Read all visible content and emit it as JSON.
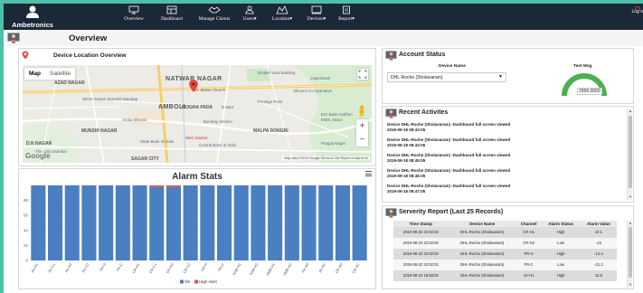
{
  "brand": {
    "name": "Ambetronics"
  },
  "nav": {
    "items": [
      {
        "label": "Overview",
        "icon": "monitor-icon"
      },
      {
        "label": "Dashboard",
        "icon": "dashboard-icon"
      },
      {
        "label": "Manage Clients",
        "icon": "handshake-icon"
      },
      {
        "label": "Users",
        "icon": "users-icon",
        "caret": "▾"
      },
      {
        "label": "Location",
        "icon": "location-icon",
        "caret": "▾"
      },
      {
        "label": "Devices",
        "icon": "device-icon",
        "caret": "▾"
      },
      {
        "label": "Report",
        "icon": "report-icon",
        "caret": "▾"
      }
    ],
    "logout_label": "Log o"
  },
  "page": {
    "title": "Overview"
  },
  "map_panel": {
    "title": "Device Location Overview",
    "map_types": [
      "Map",
      "Satellite"
    ],
    "labels": {
      "natwar": "NATWAR NAGAR",
      "azad": "AZAD NAGAR",
      "amboli": "AMBOLI",
      "munshi": "MUNSHI NAGAR",
      "malpa": "MALPA DONGRI",
      "mogra": "MOGRA PADA",
      "sagar": "SAGAR CITY",
      "dn": "D.N NAGAR",
      "empire": "Empire View Building",
      "jogeshwari": "Jogeshwari",
      "shree": "Shree Swami Samarth Mandap",
      "stblaise": "St. Blaise Church",
      "prestige": "Prestige Point",
      "amba": "Amba Bhavan",
      "bombay": "Bombay Kitchen",
      "bmc": "BMC Market",
      "central": "Central Bank of India",
      "cityclub": "The Club Mumbai",
      "pragati": "Pragati Nagar",
      "sbi": "State Bank of India",
      "ecl": "ECI Bank Andheri",
      "midc": "MIDC Marol",
      "bhoomi": "Bhoomi Co Operative",
      "dmart": "D Mart"
    },
    "google": "Google",
    "attribution": "Map data ©2019 Google   Terms of Use   Report a map error"
  },
  "alarm_chart": {
    "type": "bar",
    "title": "Alarm Stats",
    "categories": [
      "Air-H1",
      "Air-C1",
      "Air-H2",
      "Air-C2",
      "PA-H",
      "PA-C",
      "CR-H1",
      "CR-C1",
      "CR-H2",
      "CR-C2",
      "FR-H",
      "FR-C",
      "AHB-H1",
      "AHB-H2",
      "AMB-H1",
      "AMB-H2",
      "Air-4H",
      "Air-4C",
      "CR-4H",
      "CR-4C"
    ],
    "series": [
      {
        "name": "OK",
        "color": "#4a7fc1",
        "values": [
          100,
          100,
          100,
          100,
          100,
          100,
          100,
          98,
          98,
          100,
          100,
          100,
          100,
          100,
          100,
          100,
          100,
          100,
          100,
          100
        ]
      },
      {
        "name": "High Alert",
        "color": "#d9534f",
        "values": [
          0,
          0,
          0,
          0,
          0,
          0,
          0,
          2,
          2,
          0,
          0,
          0,
          0,
          0,
          0,
          0,
          0,
          0,
          0,
          0
        ]
      }
    ],
    "yticks": [
      0,
      20,
      40,
      60,
      80
    ],
    "ylim": [
      0,
      100
    ],
    "legend": "bottom"
  },
  "account_status": {
    "title": "Account Status",
    "device_name_label": "Device Name",
    "test_msg_label": "Test Msg",
    "selected_device": "DHL-Roche (Sholavaram)",
    "gauge_value": "2956.0000",
    "gauge_color": "#4caf50"
  },
  "recent_activities": {
    "title": "Recent Activites",
    "items": [
      {
        "text": "Device DHL-Roche (Sholavaram) -Dashboard full screen viewed",
        "time": "2019-09-18 08:43:05"
      },
      {
        "text": "Device DHL-Roche (Sholavaram) -Dashboard full screen viewed",
        "time": "2019-09-18 08:44:06"
      },
      {
        "text": "Device DHL-Roche (Sholavaram) -Dashboard full screen viewed",
        "time": "2019-09-18 08:45:05"
      },
      {
        "text": "Device DHL-Roche (Sholavaram) -Dashboard full screen viewed",
        "time": "2019-09-18 08:46:05"
      },
      {
        "text": "Device DHL-Roche (Sholavaram) -Dashboard full screen viewed",
        "time": "2019-09-18 08:47:05"
      }
    ]
  },
  "severity_report": {
    "title": "Serverity Report (Last 25 Records)",
    "columns": [
      "Time Stamp",
      "Device Name",
      "Channel",
      "Alarm Status",
      "Alarm Value"
    ],
    "rows": [
      [
        "2019-08-22 22:02:03",
        "DHL-Roche (Sholavaram)",
        "CR-H1",
        "High",
        "10.1"
      ],
      [
        "2019-08-22 22:02:03",
        "DHL-Roche (Sholavaram)",
        "CR-H2",
        "Low",
        "-22"
      ],
      [
        "2019-08-22 22:02:03",
        "DHL-Roche (Sholavaram)",
        "FR-H",
        "High",
        "-12.4"
      ],
      [
        "2019-08-22 22:02:03",
        "DHL-Roche (Sholavaram)",
        "FR-C",
        "Low",
        "-21.2"
      ],
      [
        "2019-08-23 18:58:03",
        "DHL-Roche (Sholavaram)",
        "Air-H1",
        "High",
        "12.6"
      ]
    ]
  }
}
